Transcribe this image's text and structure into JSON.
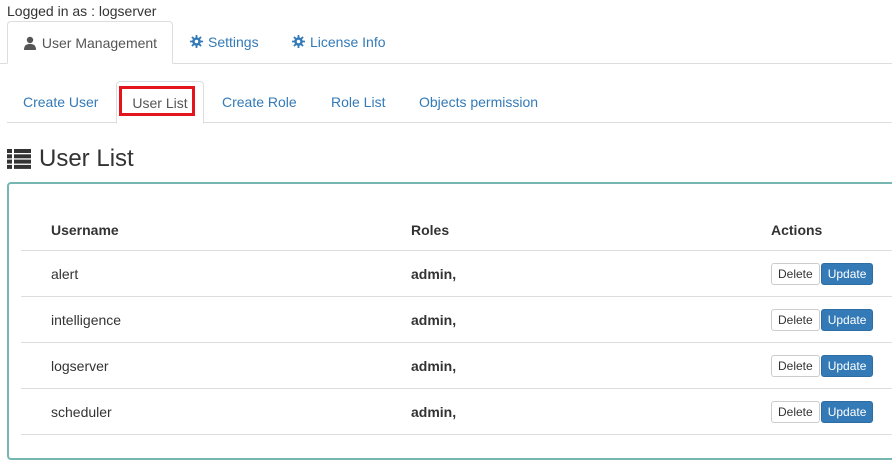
{
  "session": {
    "logged_in_text": "Logged in as : logserver"
  },
  "top_tabs": [
    {
      "label": "User Management",
      "icon": "user-icon",
      "active": true
    },
    {
      "label": "Settings",
      "icon": "gear-icon",
      "active": false
    },
    {
      "label": "License Info",
      "icon": "gear-icon",
      "active": false
    }
  ],
  "sub_tabs": [
    {
      "label": "Create User",
      "active": false
    },
    {
      "label": "User List",
      "active": true
    },
    {
      "label": "Create Role",
      "active": false
    },
    {
      "label": "Role List",
      "active": false
    },
    {
      "label": "Objects permission",
      "active": false
    }
  ],
  "heading": {
    "title": "User List",
    "icon": "list-icon"
  },
  "table": {
    "headers": {
      "username": "Username",
      "roles": "Roles",
      "actions": "Actions"
    },
    "rows": [
      {
        "username": "alert",
        "roles": "admin,"
      },
      {
        "username": "intelligence",
        "roles": "admin,"
      },
      {
        "username": "logserver",
        "roles": "admin,"
      },
      {
        "username": "scheduler",
        "roles": "admin,"
      }
    ],
    "actions": {
      "delete_label": "Delete",
      "update_label": "Update"
    }
  },
  "colors": {
    "link": "#337ab7",
    "highlight": "#e3141b",
    "panel_border": "#76b7b2",
    "primary_button": "#337ab7"
  }
}
